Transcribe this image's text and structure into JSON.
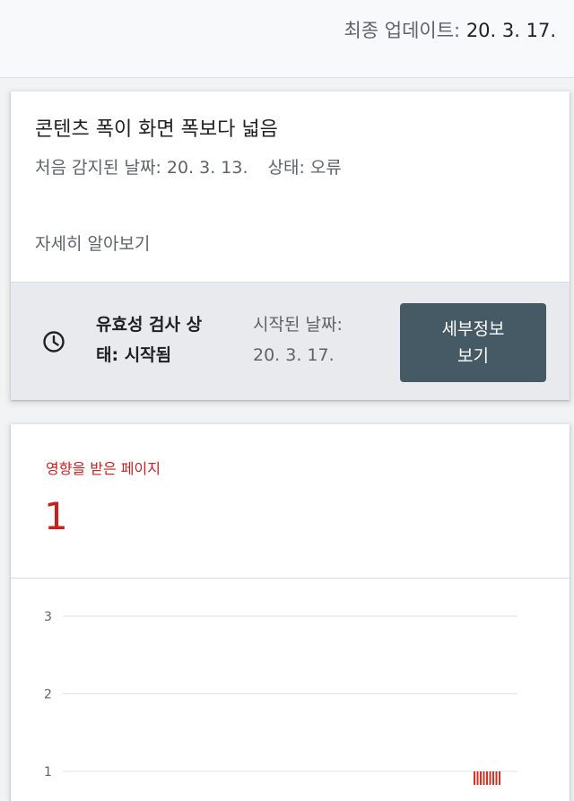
{
  "header": {
    "updated_label": "최종 업데이트:",
    "updated_date": "20. 3. 17."
  },
  "issue": {
    "title": "콘텐츠 폭이 화면 폭보다 넓음",
    "first_detected": "처음 감지된 날짜: 20. 3. 13.",
    "status": "상태: 오류",
    "learn_more": "자세히 알아보기"
  },
  "validation": {
    "icon": "clock-icon",
    "label_line1": "유효성 검사 상",
    "label_line2": "태: 시작됨",
    "started_line1": "시작된 날짜:",
    "started_line2": "20. 3. 17.",
    "button_line1": "세부정보",
    "button_line2": "보기"
  },
  "affected": {
    "label": "영향을 받은 페이지",
    "count": "1"
  },
  "chart_data": {
    "type": "bar",
    "ylim": [
      0,
      3
    ],
    "y_ticks": [
      "1",
      "2",
      "3"
    ],
    "grid": true,
    "bar_color": "#d93025",
    "values": [
      1
    ]
  }
}
